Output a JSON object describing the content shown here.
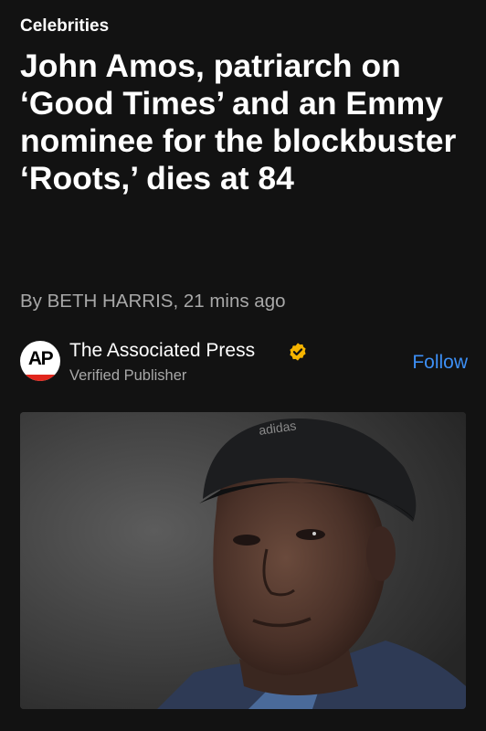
{
  "article": {
    "category": "Celebrities",
    "headline": "John Amos, patriarch on ‘Good Times’ and an Emmy nominee for the blockbuster ‘Roots,’ dies at 84",
    "byline": "By BETH HARRIS, 21 mins ago"
  },
  "publisher": {
    "logo_text": "AP",
    "name": "The Associated Press",
    "status": "Verified Publisher",
    "follow_label": "Follow",
    "badge_icon": "verified-check-icon"
  },
  "hero_image": {
    "cap_text": "adidas"
  },
  "colors": {
    "background": "#121212",
    "accent": "#3d8ff5",
    "verified_badge": "#f5b400",
    "ap_red": "#e1261c"
  }
}
